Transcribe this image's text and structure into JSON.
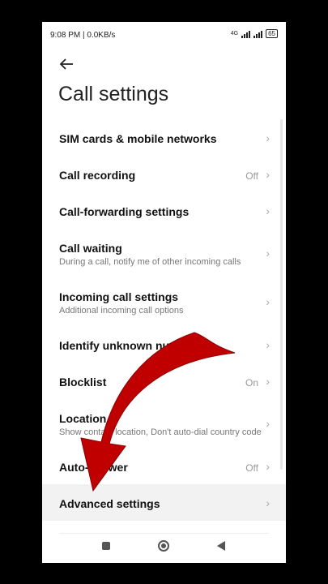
{
  "status_bar": {
    "time": "9:08 PM",
    "speed": "0.0KB/s",
    "network_type": "4G",
    "battery": "65"
  },
  "header": {
    "back_icon": "arrow-left-icon",
    "title": "Call settings"
  },
  "items": [
    {
      "label": "SIM cards & mobile networks",
      "sub": "",
      "value": ""
    },
    {
      "label": "Call recording",
      "sub": "",
      "value": "Off"
    },
    {
      "label": "Call-forwarding settings",
      "sub": "",
      "value": ""
    },
    {
      "label": "Call waiting",
      "sub": "During a call, notify me of other incoming calls",
      "value": ""
    },
    {
      "label": "Incoming call settings",
      "sub": "Additional incoming call options",
      "value": ""
    },
    {
      "label": "Identify unknown numbers",
      "sub": "",
      "value": ""
    },
    {
      "label": "Blocklist",
      "sub": "",
      "value": "On"
    },
    {
      "label": "Location",
      "sub": "Show contact location, Don't auto-dial country code",
      "value": ""
    },
    {
      "label": "Auto-answer",
      "sub": "",
      "value": "Off"
    },
    {
      "label": "Advanced settings",
      "sub": "",
      "value": ""
    }
  ],
  "chevron": "›",
  "colors": {
    "overlay_arrow": "#c00000",
    "background": "#000000"
  },
  "nav_bar": {
    "recents_icon": "square-icon",
    "home_icon": "circle-icon",
    "back_icon": "triangle-back-icon"
  }
}
